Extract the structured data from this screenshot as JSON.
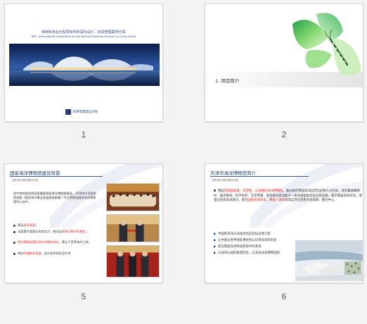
{
  "slides": [
    {
      "number": "1",
      "title": "BIM技术在大型项目中的深化设计、协调管理案例分享",
      "subtitle": "BIM - International Competition for the National Maritime Museum Of China,Tianjin",
      "logo_text": "天津市建筑设计院"
    },
    {
      "number": "2",
      "title": "1. 项目简介"
    },
    {
      "number": "5",
      "title": "国家海洋博物馆建设背景",
      "subtitle": "国家海洋博物馆建设背景",
      "paragraph": "党中央和国务院高度重视国家海洋博物馆建设。2008年2月国务院批复《国家海洋事业发展规划纲要》中已将建设国家海洋博物馆列入其中。",
      "bullets": [
        {
          "pre": "建设",
          "red": "海洋强国",
          "post": "；"
        },
        {
          "pre": "全面提升我国文化软实力，推动全民",
          "red": "海洋意识的普及",
          "post": "；"
        },
        {
          "pre": "",
          "red": "提升我国在国际海洋领域的地位",
          "post": "，建立于世界海洋之林；"
        },
        {
          "pre": "带动",
          "red": "滨海新区发展",
          "post": "，充分发挥其社会作用"
        }
      ]
    },
    {
      "number": "6",
      "title": "天津市海洋博物馆简介",
      "subtitle": "国家海洋博物馆建设背景",
      "intro": {
        "pre": "我国",
        "red1": "首座国家级、综合性、公益性的海洋博物馆",
        "mid": "，通过展示我国海洋自然历史和人文历史，成为集收藏保护、展示教育、科学研究、交流传播、旅游观光等功能于一体的国家级文化公共设施，展示我国海洋文化，增强全民族海洋意识，成为",
        "red2": "国家海洋文化、建设一流的",
        "post": "海洋自然历史和文化科研、展示中心。"
      },
      "list": [
        "中国的海洋与海洋文化历史标志性工程",
        "让中国与世界朋友更好地认识到海洋的历史",
        "成为我国海洋科技研究中的高地",
        "与海洋公园的旅游结合，与滨海海洋博物馆相"
      ]
    }
  ]
}
